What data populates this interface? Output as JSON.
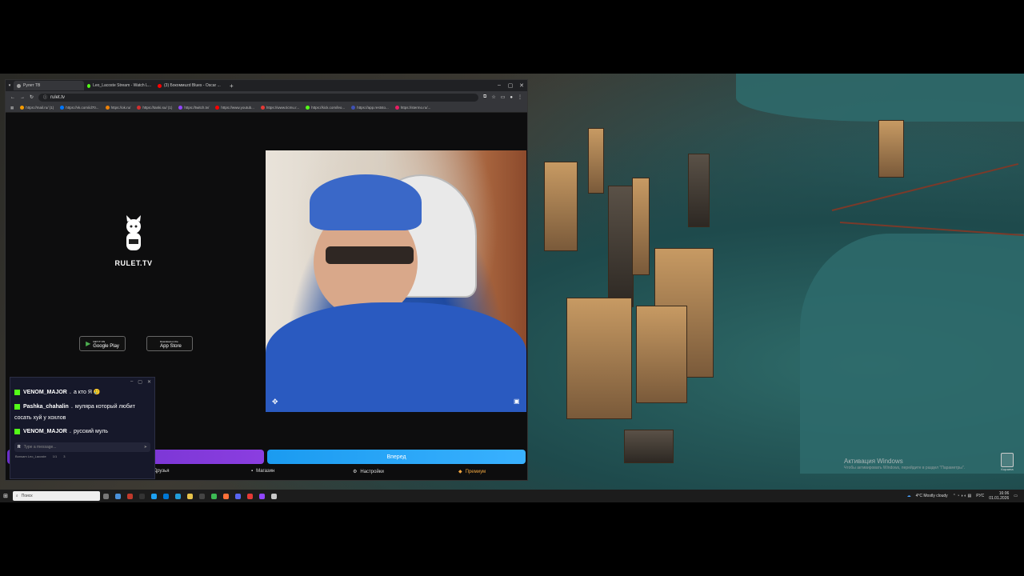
{
  "browser": {
    "tabs": [
      {
        "label": "Рулет ТВ",
        "color": "#a0a0a0"
      },
      {
        "label": "Leo_Lacoste Stream - Watch L...",
        "color": "#53fc18"
      },
      {
        "label": "(3) Бокоммuzd Blues - Oscar ...",
        "color": "#ff0000"
      }
    ],
    "new_tab": "+",
    "window_controls": [
      "–",
      "▢",
      "✕"
    ],
    "url": "rulet.tv",
    "bookmarks": [
      {
        "label": "https://mail.ru/ (1)",
        "color": "#f59b00"
      },
      {
        "label": "https://vk.com/id70...",
        "color": "#0077ff"
      },
      {
        "label": "https://ok.ru/",
        "color": "#ee8208"
      },
      {
        "label": "https://tanki.su/ (1)",
        "color": "#d32f2f"
      },
      {
        "label": "https://twitch.tv/",
        "color": "#9146ff"
      },
      {
        "label": "https://www.youtub...",
        "color": "#ff0000"
      },
      {
        "label": "https://www.ticmu.r...",
        "color": "#e53935"
      },
      {
        "label": "https://kick.com/leo...",
        "color": "#53fc18"
      },
      {
        "label": "https://app.reststo...",
        "color": "#3f51b5"
      },
      {
        "label": "https://stermo.ru/...",
        "color": "#e91e63"
      }
    ]
  },
  "rulet": {
    "brand": "RULET.TV",
    "google_play": {
      "small": "GET IT ON",
      "label": "Google Play"
    },
    "app_store": {
      "small": "Download on the",
      "label": "App Store"
    },
    "next_button": "Вперед",
    "nav": [
      "Друзья",
      "Магазин",
      "Настройки",
      "Премиум"
    ]
  },
  "chat": {
    "controls": [
      "–",
      "▢",
      "✕"
    ],
    "messages": [
      {
        "user": "VENOM_MAJOR",
        "text": "а кто Я 🥲"
      },
      {
        "user": "Pashka_chahalin",
        "text": "мулярa который любит сосать хуй у хохлов"
      },
      {
        "user": "VENOM_MAJOR",
        "text": "русский муль"
      }
    ],
    "input_placeholder": "Type a message...",
    "footer_channel": "Bonsam Leo_Lacoste",
    "footer_viewers": "1/1",
    "footer_count": "3"
  },
  "desktop": {
    "activation_title": "Активация Windows",
    "activation_text": "Чтобы активировать Windows, перейдите в раздел \"Параметры\".",
    "recycle_label": "Корзина"
  },
  "taskbar": {
    "search_placeholder": "Поиск",
    "weather": "4°C Mostly cloudy",
    "lang": "РУС",
    "time": "16:06",
    "date": "01.01.2026"
  }
}
